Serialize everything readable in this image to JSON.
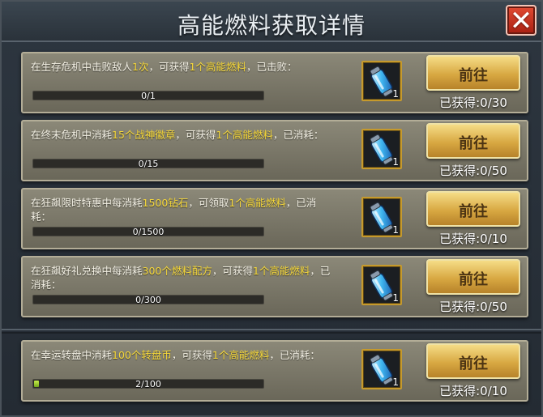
{
  "title": "高能燃料获取详情",
  "close_label": "✕",
  "tasks": [
    {
      "desc_parts": [
        "在生存危机中击败敌人",
        "1次",
        "，可获得",
        "1个高能燃料",
        "，已击败："
      ],
      "progress_text": "0/1",
      "progress_fraction": 0,
      "item_count": "1",
      "button_label": "前往",
      "obtained": "已获得:0/30"
    },
    {
      "desc_parts": [
        "在终末危机中消耗",
        "15个战神徽章",
        "，可获得",
        "1个高能燃料",
        "，已消耗："
      ],
      "progress_text": "0/15",
      "progress_fraction": 0,
      "item_count": "1",
      "button_label": "前往",
      "obtained": "已获得:0/50"
    },
    {
      "desc_parts": [
        "在狂飙限时特惠中每消耗",
        "1500钻石",
        "，可领取",
        "1个高能燃料",
        "，已消耗："
      ],
      "progress_text": "0/1500",
      "progress_fraction": 0,
      "item_count": "1",
      "button_label": "前往",
      "obtained": "已获得:0/10"
    },
    {
      "desc_parts": [
        "在狂飙好礼兑换中每消耗",
        "300个燃料配方",
        "，可获得",
        "1个高能燃料",
        "，已消耗："
      ],
      "progress_text": "0/300",
      "progress_fraction": 0,
      "item_count": "1",
      "button_label": "前往",
      "obtained": "已获得:0/50"
    },
    {
      "desc_parts": [
        "在幸运转盘中消耗",
        "100个转盘币",
        "，可获得",
        "1个高能燃料",
        "，已消耗："
      ],
      "progress_text": "2/100",
      "progress_fraction": 0.02,
      "item_count": "1",
      "button_label": "前往",
      "obtained": "已获得:0/10"
    }
  ],
  "colors": {
    "highlight": "#f7d93a",
    "button": "#d8a842",
    "close": "#c8301c",
    "progress_fill": "#9ccd32"
  },
  "icons": {
    "close": "close-icon",
    "item": "fuel-canister-icon"
  }
}
